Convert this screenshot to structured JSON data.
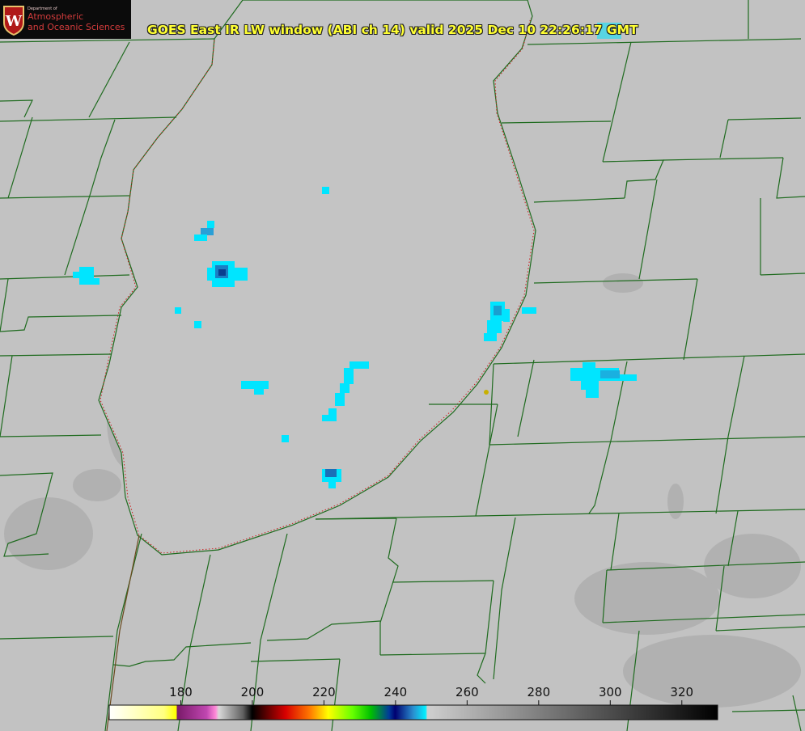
{
  "title": "GOES East IR LW window (ABI ch 14) valid 2025 Dec 10 22:26:17 GMT",
  "logo": {
    "crest_letter": "W",
    "dept_text": "Department of",
    "line1": "Atmospheric",
    "line2": "and Oceanic Sciences"
  },
  "colorbar": {
    "units_range": [
      160,
      330
    ],
    "ticks": [
      {
        "value": 180,
        "label": "180"
      },
      {
        "value": 200,
        "label": "200"
      },
      {
        "value": 220,
        "label": "220"
      },
      {
        "value": 240,
        "label": "240"
      },
      {
        "value": 260,
        "label": "260"
      },
      {
        "value": 280,
        "label": "280"
      },
      {
        "value": 300,
        "label": "300"
      },
      {
        "value": 320,
        "label": "320"
      }
    ]
  },
  "colors": {
    "background": "#c2c2c2",
    "borders": "#1f6b1f",
    "title": "#ffff33",
    "cold_cloud": "#00e5ff",
    "cold_core": "#1a5fb4"
  }
}
